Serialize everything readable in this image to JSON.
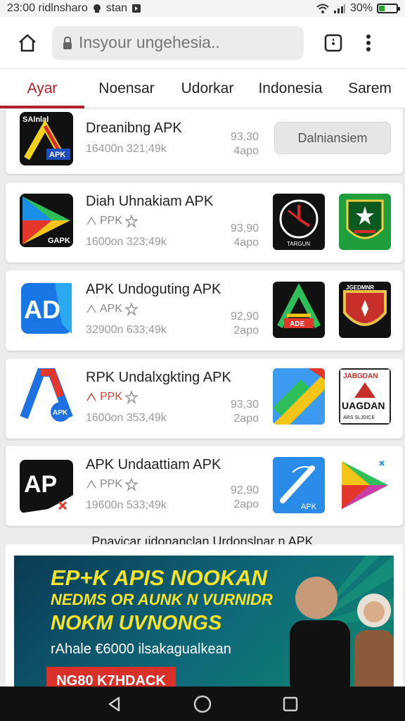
{
  "status_bar": {
    "time_text": "23:00 ridlnsharo",
    "carrier": "stan",
    "battery_percent": "30%",
    "battery_level": 0.3
  },
  "browser": {
    "url_placeholder": "Insyour ungehesia.."
  },
  "tabs": [
    {
      "label": "Ayar",
      "active": true
    },
    {
      "label": "Noensar",
      "active": false
    },
    {
      "label": "Udorkar",
      "active": false
    },
    {
      "label": "Indonesia",
      "active": false
    },
    {
      "label": "Sarem",
      "active": false
    }
  ],
  "apps": [
    {
      "title": "Dreanibng APK",
      "meta": "16400n 321;49k",
      "rating_top": "93,30",
      "rating_bottom": "4apo",
      "button_label": "Dalniansiem",
      "icon_text": "SAlnlal",
      "icon_badge": "APK"
    },
    {
      "title": "Diah Uhnakiam APK",
      "dev": "PPK",
      "meta": "1600on 323;49k",
      "rating_top": "93,90",
      "rating_bottom": "4apo",
      "icon_badge": "GAPK",
      "thumb1_text": "TARGUN"
    },
    {
      "title": "APK Undoguting APK",
      "dev": "APK",
      "meta": "32900n 633;49k",
      "rating_top": "92,90",
      "rating_bottom": "2apo",
      "icon_text": "AD",
      "thumb1_text": "ADE",
      "thumb2_text": "JGEDMNR"
    },
    {
      "title": "RPK Undalxgkting APK",
      "dev": "PPK",
      "meta": "1600on 353,49k",
      "rating_top": "93,30",
      "rating_bottom": "2apo",
      "icon_badge": "APK",
      "thumb2_text": "JABGDAN",
      "thumb2_sub": "UAGDAN",
      "thumb2_foot": "ARS SLJDICE"
    },
    {
      "title": "APK Undaattiam APK",
      "dev": "PPK",
      "meta": "19600n 533;49k",
      "rating_top": "92,90",
      "rating_bottom": "2apo",
      "icon_text": "AP",
      "thumb1_text": "APK"
    }
  ],
  "section_title": "Pnayicar ıidonanclan Urdonslnar n APK",
  "banner": {
    "line1": "EP+K APIS NOOKAN",
    "line2": "NEDMS OR AUNK N VURNIDR",
    "line3": "NOKM UVNONGS",
    "line4": "rAhale €6000 ilsakagualkean",
    "cta": "NG80 K7HDACK"
  },
  "colors": {
    "accent": "#b3202c",
    "banner_text": "#f4e32a"
  }
}
